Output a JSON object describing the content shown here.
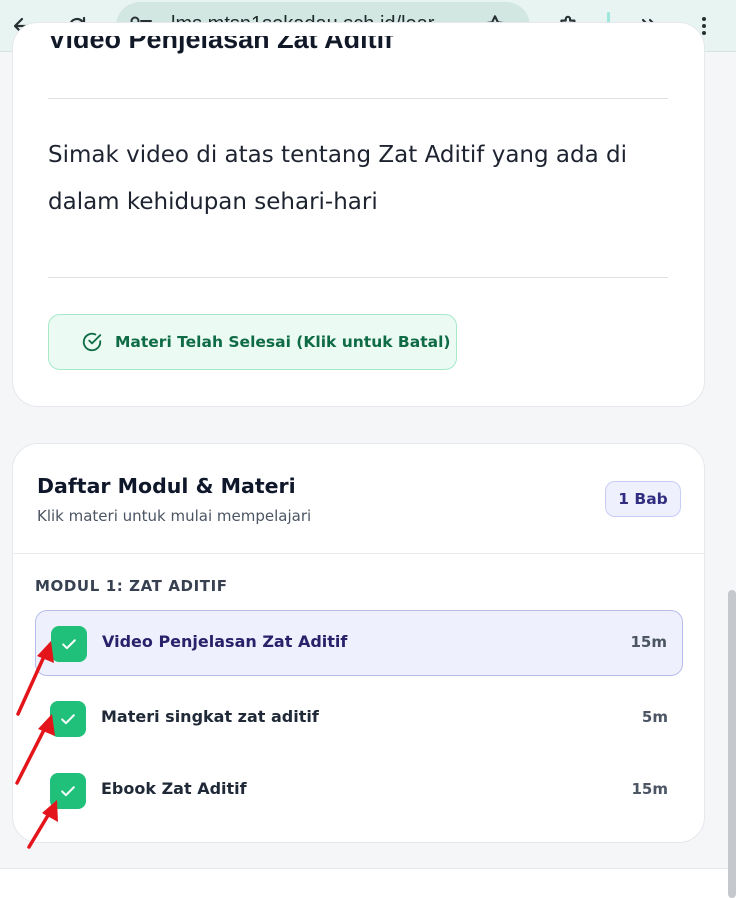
{
  "browser": {
    "url": "lms.mtsn1sekadau.sch.id/lear...",
    "icons": [
      "back-arrow-icon",
      "reload-icon",
      "site-settings-icon",
      "bookmark-star-icon",
      "extensions-icon",
      "more-tools-icon",
      "menu-dots-icon"
    ]
  },
  "lesson_content": {
    "heading": "Video Penjelasan Zat Aditif",
    "description": "Simak video di atas tentang Zat Aditif yang ada di dalam kehidupan sehari-hari",
    "complete_button_label": "Materi Telah Selesai (Klik untuk Batal)"
  },
  "modules": {
    "title": "Daftar Modul & Materi",
    "subtitle": "Klik materi untuk mulai mempelajari",
    "badge": "1 Bab",
    "sections": [
      {
        "label": "MODUL 1: ZAT ADITIF",
        "lessons": [
          {
            "name": "Video Penjelasan Zat Aditif",
            "duration": "15m",
            "completed": true,
            "active": true
          },
          {
            "name": "Materi singkat zat aditif",
            "duration": "5m",
            "completed": true,
            "active": false
          },
          {
            "name": "Ebook Zat Aditif",
            "duration": "15m",
            "completed": true,
            "active": false
          }
        ]
      }
    ]
  },
  "colors": {
    "accent_green": "#20c07a",
    "done_button_bg": "#ebfbf4",
    "active_lesson_bg": "#eef0fd",
    "annotation_arrow": "#e3151b"
  }
}
